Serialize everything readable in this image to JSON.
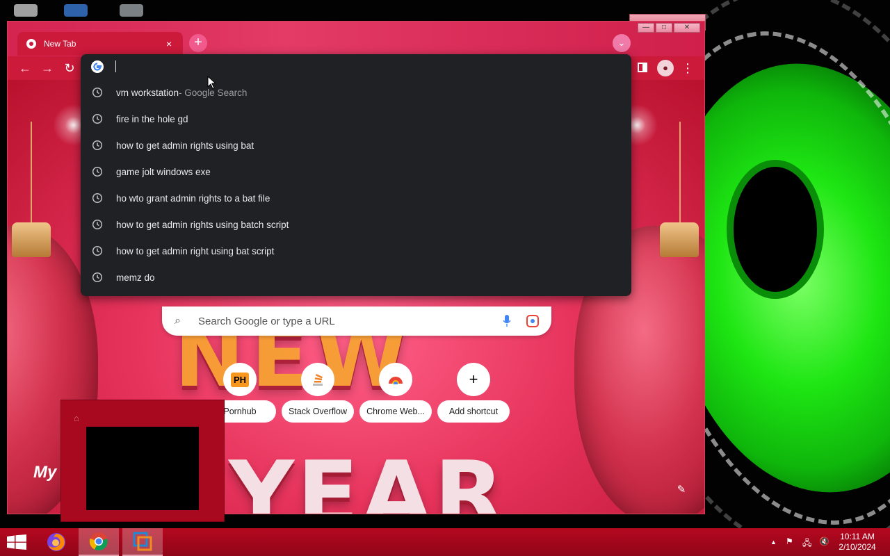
{
  "browser": {
    "tab": {
      "title": "New Tab",
      "close": "×"
    },
    "new_tab": "+",
    "toolbar": {
      "back": "←",
      "forward": "→",
      "reload": "↻",
      "menu": "⋮"
    },
    "window_controls": {
      "minimize": "—",
      "maximize": "□",
      "close": "✕"
    }
  },
  "omnibox": {
    "value": "",
    "suggestions": [
      {
        "query": "vm workstation",
        "suffix": " - Google Search"
      },
      {
        "query": "fire in the hole gd",
        "suffix": ""
      },
      {
        "query": "how to get admin rights using bat",
        "suffix": ""
      },
      {
        "query": "game jolt windows exe",
        "suffix": ""
      },
      {
        "query": "ho wto grant admin rights to a bat file",
        "suffix": ""
      },
      {
        "query": "how to get admin rights using batch script",
        "suffix": ""
      },
      {
        "query": "how to get admin right using bat script",
        "suffix": ""
      },
      {
        "query": "memz do",
        "suffix": ""
      }
    ]
  },
  "ntp": {
    "search_placeholder": "Search Google or type a URL",
    "shortcuts": [
      {
        "label": "Pornhub",
        "icon_text": "PH"
      },
      {
        "label": "Stack Overflow",
        "icon_text": ""
      },
      {
        "label": "Chrome Web...",
        "icon_text": ""
      },
      {
        "label": "Add shortcut",
        "icon_text": "+"
      }
    ],
    "art_top": "NEW",
    "art_bottom": "YEAR",
    "partial_title": "My"
  },
  "taskbar": {
    "time": "10:11 AM",
    "date": "2/10/2024",
    "apps": [
      "firefox",
      "chrome",
      "vmware"
    ]
  },
  "colors": {
    "accent": "#cc1a3b",
    "dropdown_bg": "#202124",
    "taskbar": "#a8071d"
  }
}
